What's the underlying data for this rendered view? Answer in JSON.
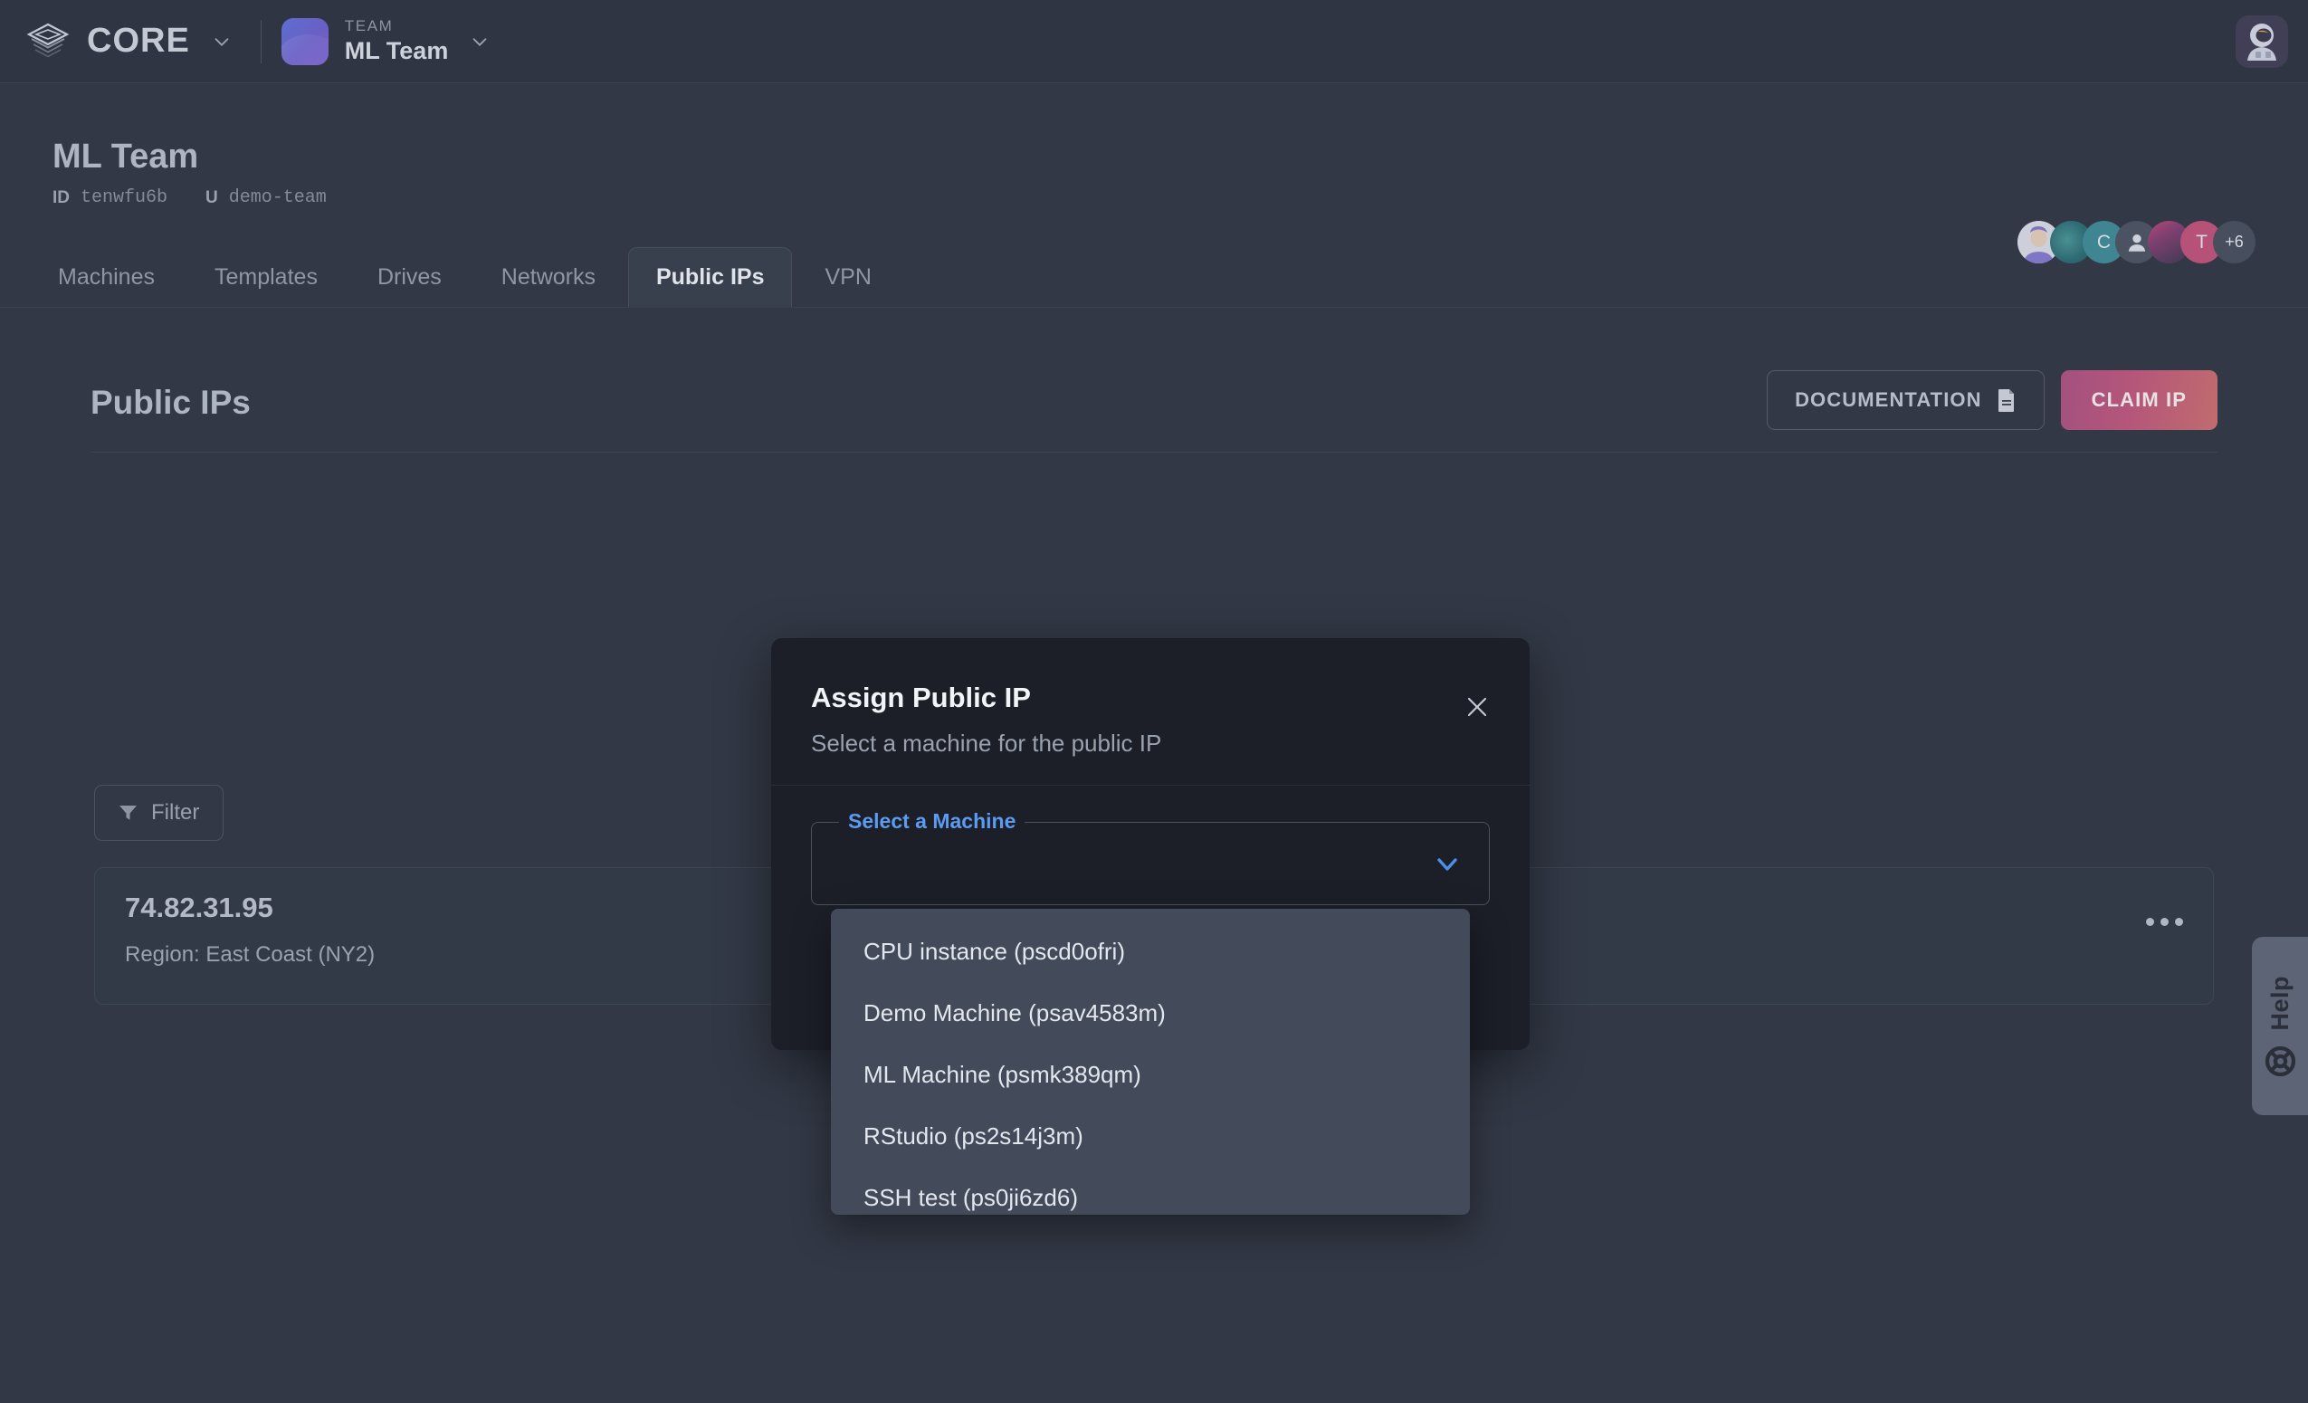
{
  "topnav": {
    "brand_name": "CORE",
    "brand_logo_icon": "layers-icon",
    "brand_chevron_icon": "chevron-down-icon",
    "team_kicker": "TEAM",
    "team_name": "ML Team",
    "team_chevron_icon": "chevron-down-icon",
    "user_avatar_icon": "astronaut-avatar"
  },
  "page_header": {
    "title": "ML Team",
    "id_key": "ID",
    "id_value": "tenwfu6b",
    "user_key": "U",
    "user_value": "demo-team",
    "members": [
      {
        "label": "",
        "name": "member-avatar-1"
      },
      {
        "label": "",
        "name": "member-avatar-2"
      },
      {
        "label": "C",
        "name": "member-avatar-3"
      },
      {
        "label": "",
        "name": "member-avatar-4"
      },
      {
        "label": "",
        "name": "member-avatar-5"
      },
      {
        "label": "T",
        "name": "member-avatar-6"
      },
      {
        "label": "+6",
        "name": "member-avatar-overflow"
      }
    ]
  },
  "tabs": [
    {
      "label": "Machines",
      "active": false
    },
    {
      "label": "Templates",
      "active": false
    },
    {
      "label": "Drives",
      "active": false
    },
    {
      "label": "Networks",
      "active": false
    },
    {
      "label": "Public IPs",
      "active": true
    },
    {
      "label": "VPN",
      "active": false
    }
  ],
  "section": {
    "title": "Public IPs",
    "documentation_label": "DOCUMENTATION",
    "documentation_icon": "document-icon",
    "claim_label": "CLAIM IP",
    "filter_label": "Filter",
    "filter_icon": "funnel-icon"
  },
  "ip_list": [
    {
      "address": "74.82.31.95",
      "region": "Region: East Coast (NY2)",
      "more_icon": "ellipsis-icon"
    }
  ],
  "modal": {
    "title": "Assign Public IP",
    "subtitle": "Select a machine for the public IP",
    "close_icon": "close-icon",
    "field_label": "Select a Machine",
    "field_value": "",
    "field_chevron_icon": "chevron-down-icon"
  },
  "dropdown": {
    "options": [
      "CPU instance (pscd0ofri)",
      "Demo Machine (psav4583m)",
      "ML Machine (psmk389qm)",
      "RStudio (ps2s14j3m)",
      "SSH test (ps0ji6zd6)"
    ]
  },
  "help": {
    "label": "Help",
    "icon": "lifebuoy-icon"
  },
  "colors": {
    "page_bg": "#323845",
    "nav_bg": "#2f3542",
    "modal_bg": "#1c1f28",
    "dropdown_bg": "#434a5a",
    "accent_blue": "#5b9bf0",
    "claim_gradient_start": "#a3517f",
    "claim_gradient_end": "#c06c6e",
    "help_bg": "#5d6475"
  }
}
